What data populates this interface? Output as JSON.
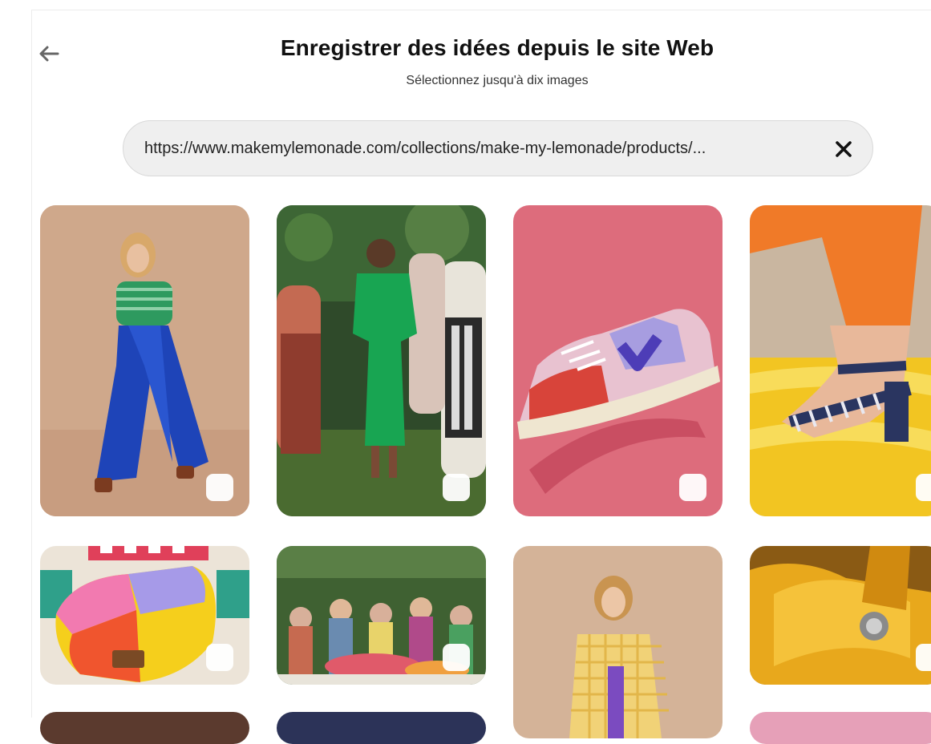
{
  "header": {
    "back_icon": "arrow-left-icon",
    "title": "Enregistrer des idées depuis le site Web",
    "subtitle": "Sélectionnez jusqu'à dix images"
  },
  "url_bar": {
    "value": "https://www.makemylemonade.com/collections/make-my-lemonade/products/...",
    "clear_icon": "close-icon"
  },
  "images": [
    {
      "id": "img-1",
      "subject": "woman in green striped top and blue wide trousers",
      "selected": false
    },
    {
      "id": "img-2",
      "subject": "group dancing outdoors, woman in green dress",
      "selected": false
    },
    {
      "id": "img-3",
      "subject": "pink and purple sneaker on pink background",
      "selected": false
    },
    {
      "id": "img-4",
      "subject": "striped heeled sandal on yellow inflatable",
      "selected": false
    },
    {
      "id": "img-5",
      "subject": "colorful patchwork belt bag",
      "selected": false
    },
    {
      "id": "img-6",
      "subject": "crowd celebrating with flowers",
      "selected": false
    },
    {
      "id": "img-7",
      "subject": "woman in yellow checked jacket",
      "selected": false
    },
    {
      "id": "img-8",
      "subject": "yellow leather bag detail",
      "selected": false
    }
  ],
  "colors": {
    "title": "#111111",
    "url_bar_bg": "#efefef",
    "checkbox": "#ffffff"
  }
}
